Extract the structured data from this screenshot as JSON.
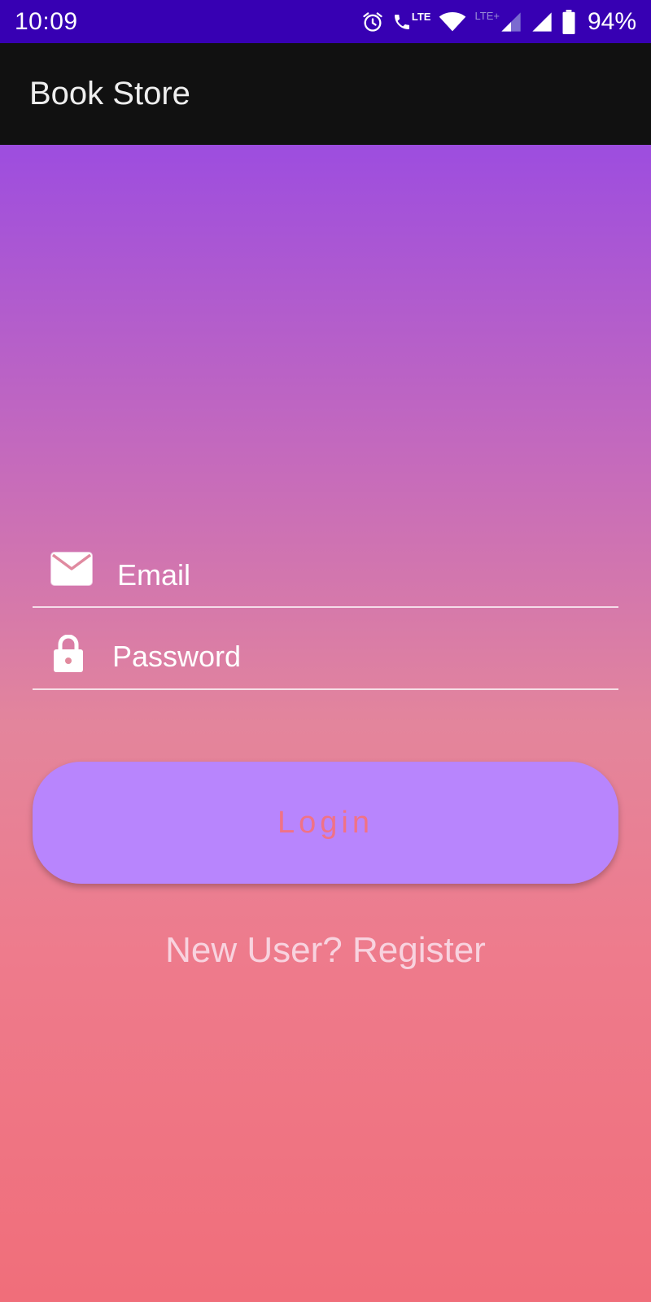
{
  "status_bar": {
    "time": "10:09",
    "network_label": "LTE",
    "network_plus_label": "LTE+",
    "battery": "94%",
    "icons": [
      "alarm-icon",
      "volte-call-icon",
      "wifi-icon",
      "signal-icon",
      "signal-icon",
      "battery-icon"
    ]
  },
  "app_bar": {
    "title": "Book Store"
  },
  "form": {
    "email": {
      "placeholder": "Email",
      "value": "",
      "icon": "mail-icon"
    },
    "password": {
      "placeholder": "Password",
      "value": "",
      "icon": "lock-icon"
    },
    "login_label": "Login",
    "register_label": "New User? Register"
  },
  "colors": {
    "status_bar": "#3700b3",
    "app_bar": "#111111",
    "gradient_top": "#9d4ddf",
    "gradient_bottom": "#f06e7a",
    "login_button": "#b885fd",
    "login_text": "#f07286"
  }
}
